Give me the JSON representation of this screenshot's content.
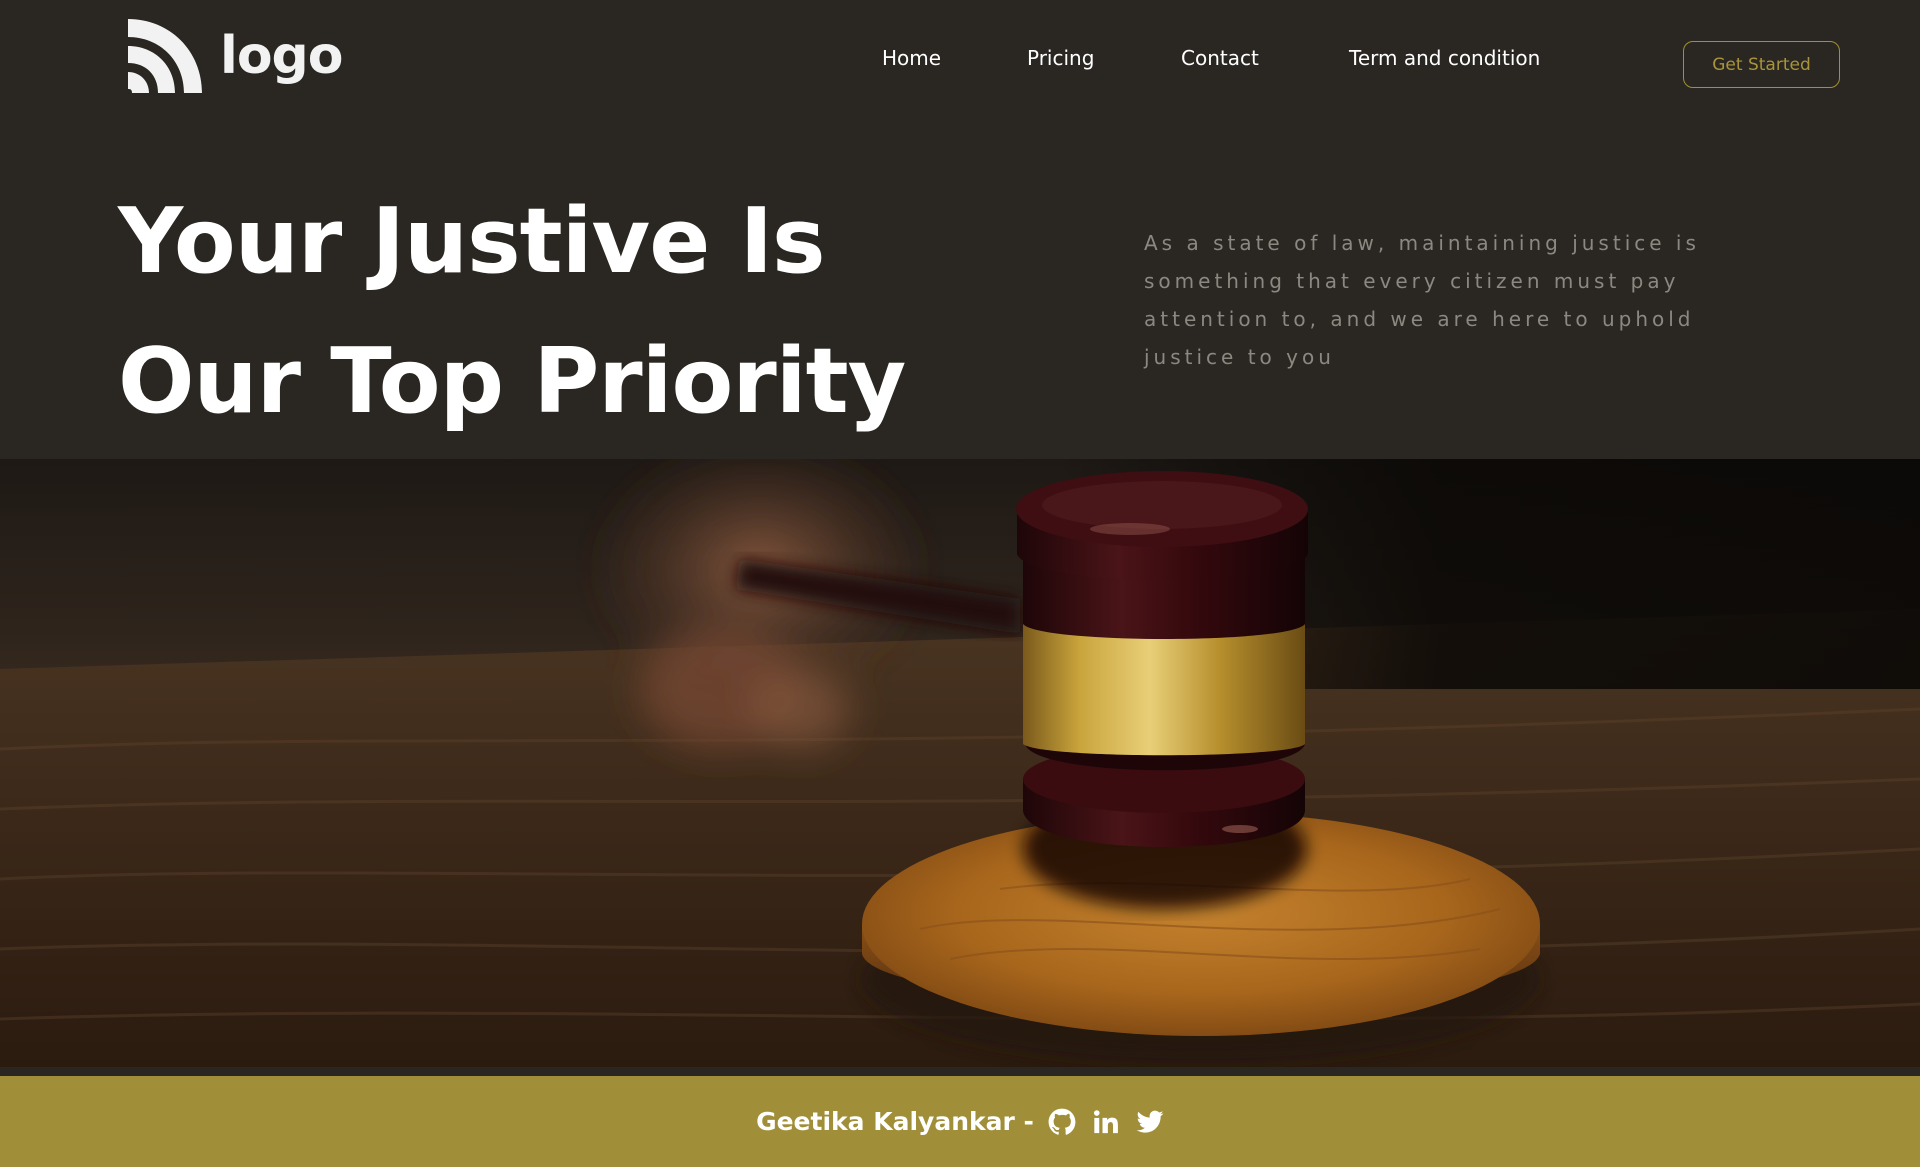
{
  "brand": {
    "logo_text": "logo",
    "logo_icon": "rss-arcs-icon"
  },
  "nav": {
    "items": [
      {
        "label": "Home"
      },
      {
        "label": "Pricing"
      },
      {
        "label": "Contact"
      },
      {
        "label": "Term and condition"
      }
    ],
    "cta_label": "Get Started"
  },
  "hero": {
    "title_line1": "Your Justive Is",
    "title_line2": "Our Top Priority",
    "description": "As a state of law, maintaining justice is something that every citizen must pay attention to, and we are here to uphold justice to you",
    "image_subject": "gavel-photo"
  },
  "footer": {
    "author_text": "Geetika Kalyankar -",
    "icons": [
      "github-icon",
      "linkedin-icon",
      "twitter-icon"
    ]
  },
  "colors": {
    "background": "#2a2722",
    "accent": "#a08f38",
    "heading": "#ffffff",
    "muted_text": "#8b8881"
  }
}
